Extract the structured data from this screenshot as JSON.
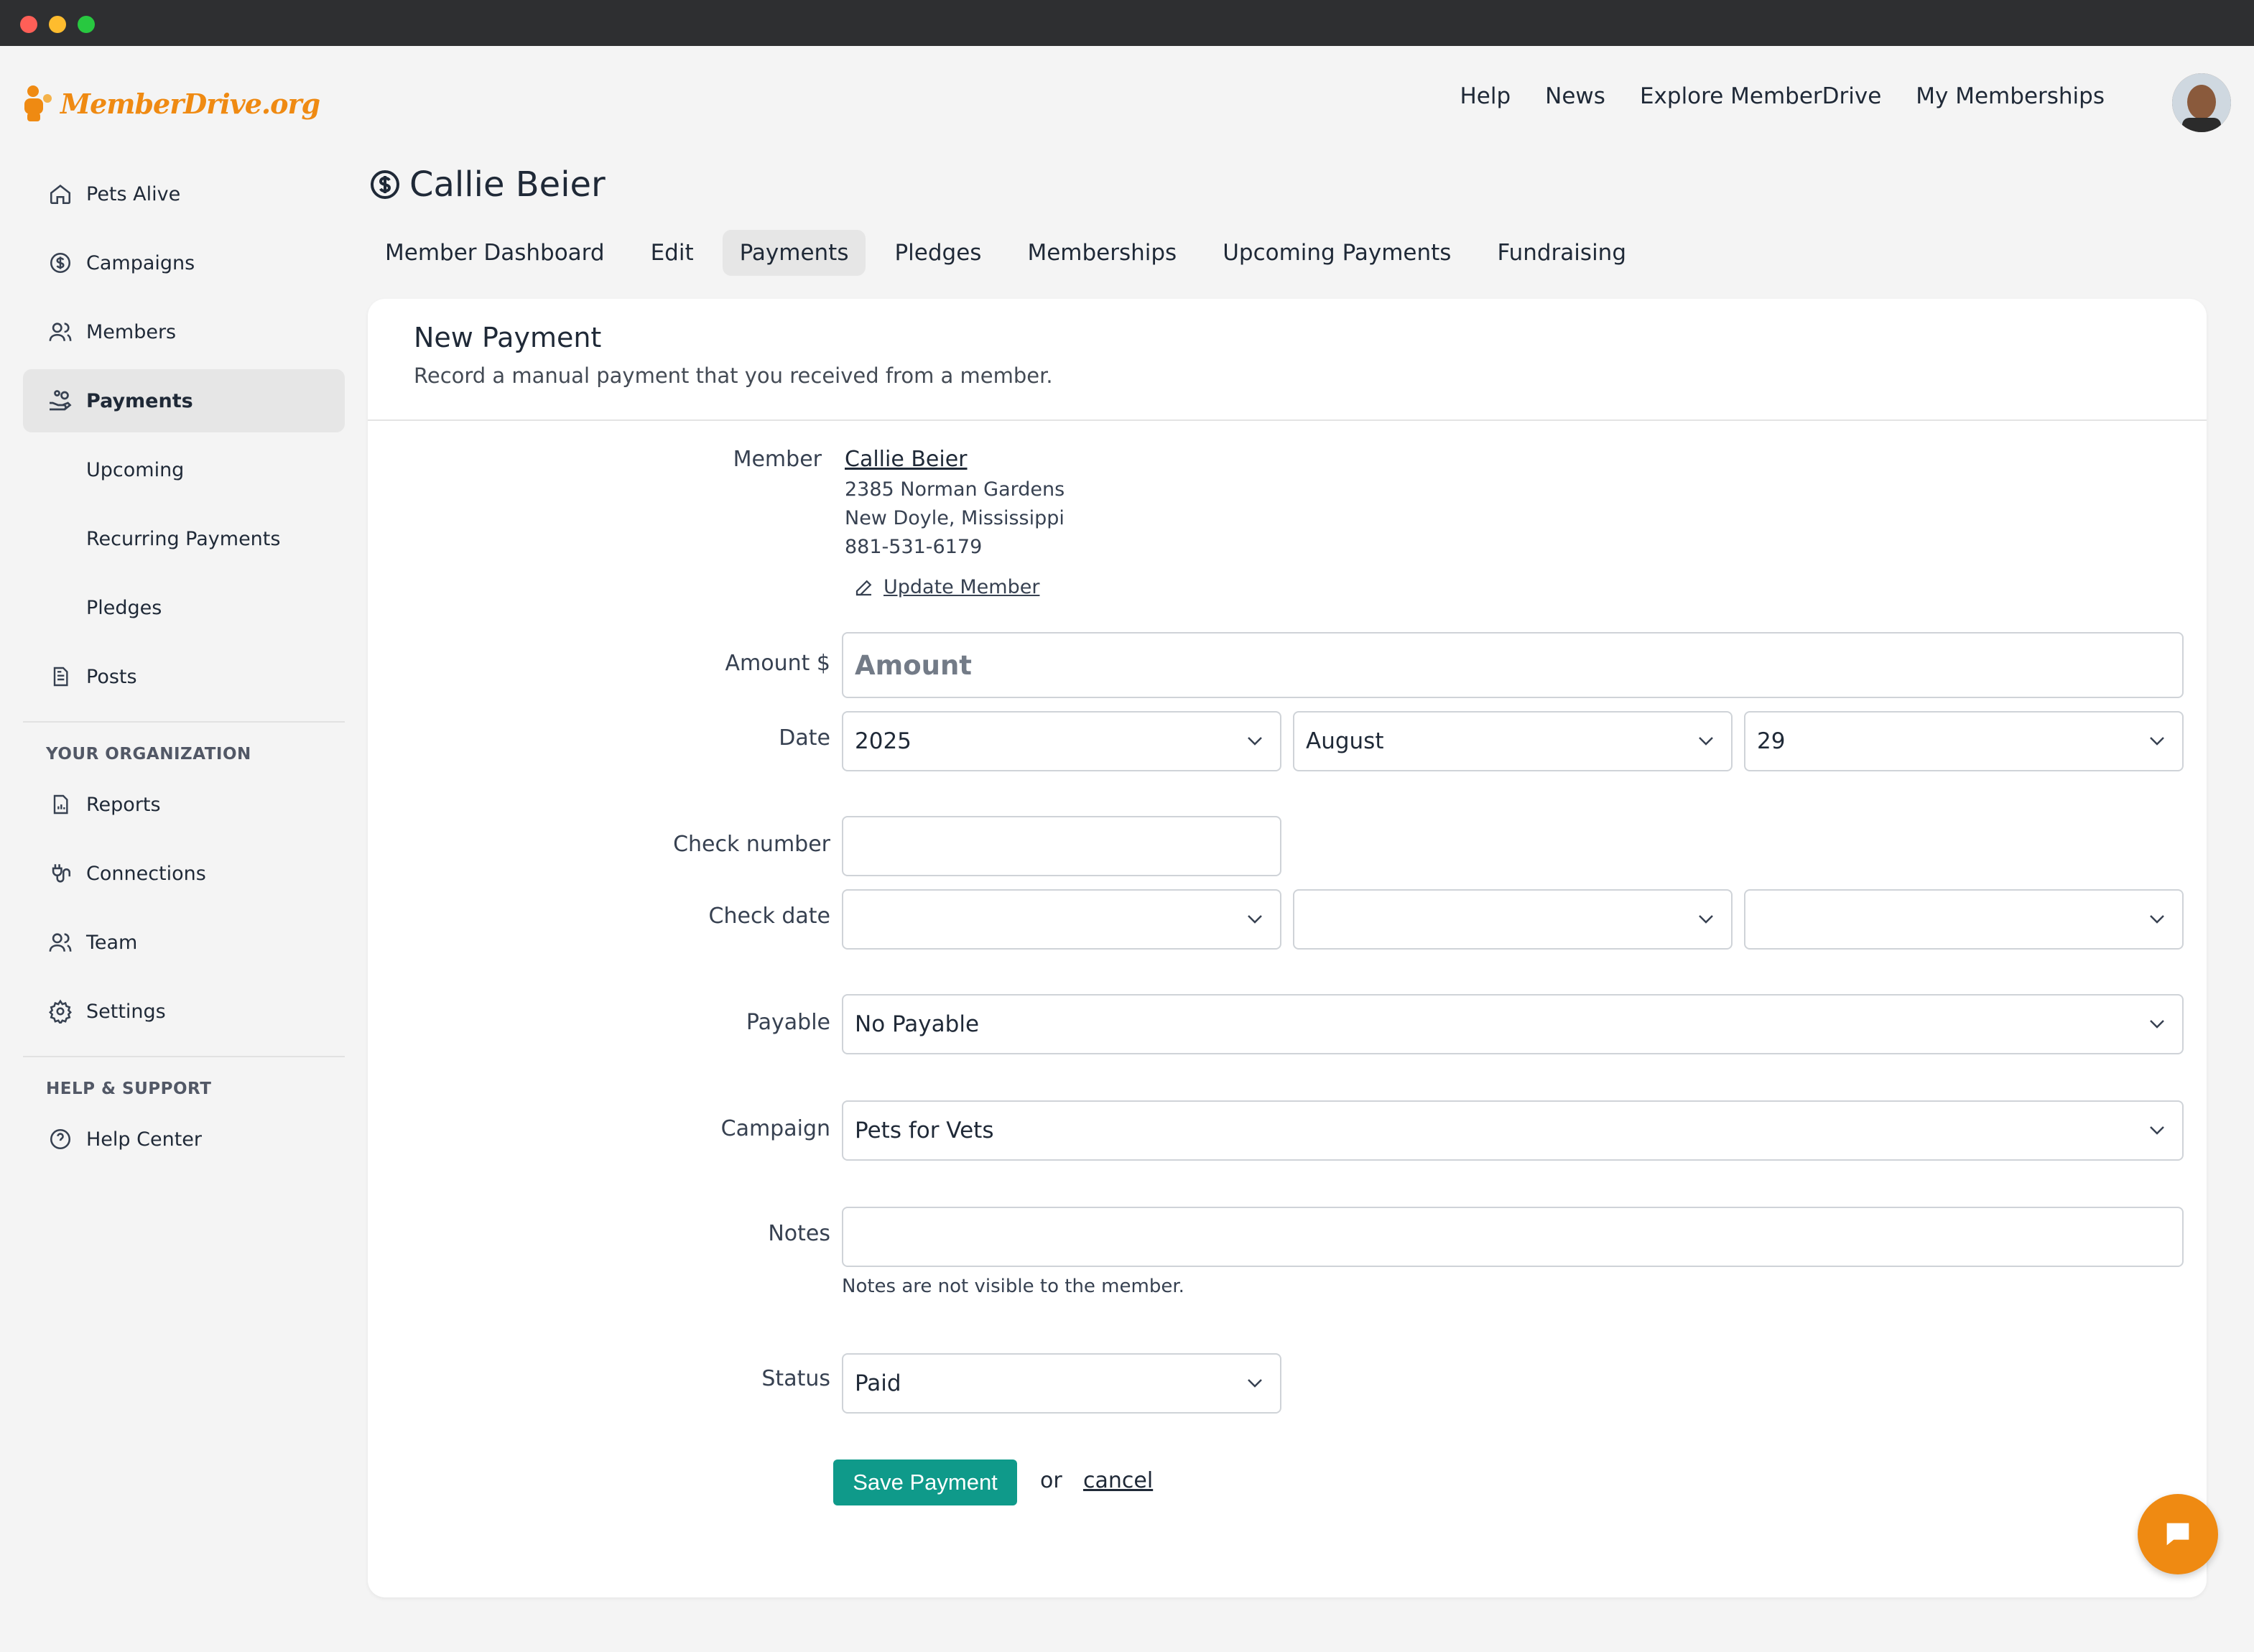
{
  "brand": {
    "name": "MemberDrive.org",
    "accent": "#ef8a12",
    "primary": "#0f9a8a"
  },
  "topnav": [
    "Help",
    "News",
    "Explore MemberDrive",
    "My Memberships"
  ],
  "sidebar": {
    "items": [
      {
        "label": "Pets Alive",
        "icon": "home-icon"
      },
      {
        "label": "Campaigns",
        "icon": "dollar-circle-icon"
      },
      {
        "label": "Members",
        "icon": "users-icon"
      },
      {
        "label": "Payments",
        "icon": "hand-coins-icon",
        "active": true
      }
    ],
    "subitems": [
      "Upcoming",
      "Recurring Payments",
      "Pledges"
    ],
    "posts": {
      "label": "Posts",
      "icon": "document-icon"
    },
    "org_heading": "YOUR ORGANIZATION",
    "org_items": [
      {
        "label": "Reports",
        "icon": "report-icon"
      },
      {
        "label": "Connections",
        "icon": "plug-icon"
      },
      {
        "label": "Team",
        "icon": "users-icon"
      },
      {
        "label": "Settings",
        "icon": "gear-icon"
      }
    ],
    "help_heading": "HELP & SUPPORT",
    "help_items": [
      {
        "label": "Help Center",
        "icon": "question-circle-icon"
      }
    ]
  },
  "page": {
    "title": "Callie Beier",
    "tabs": [
      "Member Dashboard",
      "Edit",
      "Payments",
      "Pledges",
      "Memberships",
      "Upcoming Payments",
      "Fundraising"
    ],
    "active_tab": "Payments"
  },
  "form": {
    "heading": "New Payment",
    "subheading": "Record a manual payment that you received from a member.",
    "member": {
      "label": "Member",
      "name": "Callie Beier",
      "address1": "2385 Norman Gardens",
      "address2": "New Doyle, Mississippi",
      "phone": "881-531-6179",
      "update_link": "Update Member"
    },
    "amount": {
      "label": "Amount $",
      "placeholder": "Amount"
    },
    "date": {
      "label": "Date",
      "year": "2025",
      "month": "August",
      "day": "29"
    },
    "check_number": {
      "label": "Check number",
      "value": ""
    },
    "check_date": {
      "label": "Check date"
    },
    "payable": {
      "label": "Payable",
      "value": "No Payable"
    },
    "campaign": {
      "label": "Campaign",
      "value": "Pets for Vets"
    },
    "notes": {
      "label": "Notes",
      "value": "",
      "hint": "Notes are not visible to the member."
    },
    "status": {
      "label": "Status",
      "value": "Paid"
    },
    "save_label": "Save Payment",
    "or_text": "or",
    "cancel_label": "cancel"
  }
}
